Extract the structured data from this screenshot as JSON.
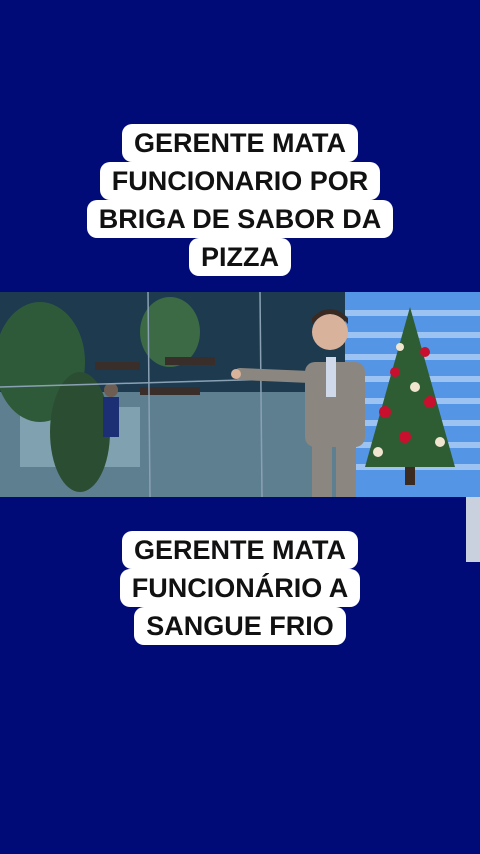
{
  "caption_top": {
    "lines": [
      "GERENTE MATA",
      "FUNCIONARIO POR",
      "BRIGA DE SABOR DA",
      "PIZZA"
    ]
  },
  "caption_bottom": {
    "lines": [
      "GERENTE MATA",
      "FUNCIONÁRIO A",
      "SANGUE FRIO"
    ]
  },
  "colors": {
    "background": "#010b78",
    "caption_bg": "#ffffff",
    "caption_text": "#111111",
    "studio_blue": "#1f62c9",
    "suit": "#8b8780"
  }
}
